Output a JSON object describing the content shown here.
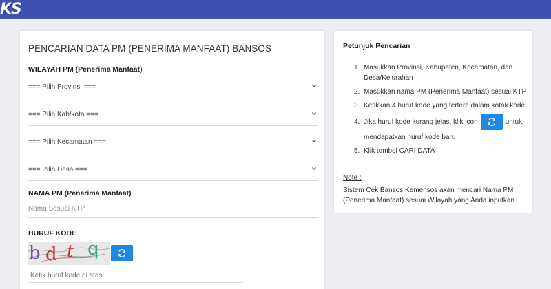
{
  "header": {
    "logo_text": "KS",
    "bar_color": "#3f51b5"
  },
  "form": {
    "title": "PENCARIAN DATA PM (PENERIMA MANFAAT) BANSOS",
    "wilayah_label": "WILAYAH PM (Penerima Manfaat)",
    "selects": {
      "provinsi": "=== Pilih Provinsi ===",
      "kabkota": "=== Pilih Kab/kota ===",
      "kecamatan": "=== Pilih Kecamatan ===",
      "desa": "=== Pilih Desa ==="
    },
    "nama_label": "NAMA PM (Penerima Manfaat)",
    "nama_placeholder": "Nama Sesuai KTP",
    "kode_label": "HURUF KODE",
    "captcha_text": "bdtq",
    "kode_placeholder": "Ketik huruf kode di atas:",
    "refresh_icon": "refresh-icon",
    "accent_color": "#1e88e5"
  },
  "help": {
    "title": "Petunjuk Pencarian",
    "steps": [
      "Masukkan Provinsi, Kabupaten, Kecamatan, dan Desa/Kelurahan",
      "Masukkan nama PM (Penerima Manfaat) sesuai KTP",
      "Ketikkan 4 huruf kode yang tertera dalam kotak kode",
      "Jika huruf kode kurang jelas, klik icon",
      "Klik tombol CARI DATA"
    ],
    "step4_suffix": "untuk",
    "step4_line2": "mendapatkan huruf kode baru",
    "numbers": [
      "1.",
      "2.",
      "3.",
      "4.",
      "5."
    ],
    "note_label": "Note :",
    "note_text": "Sistem Cek Bansos Kemensos akan mencari Nama PM (Penerima Manfaat) sesuai Wilayah yang Anda inputkan"
  }
}
